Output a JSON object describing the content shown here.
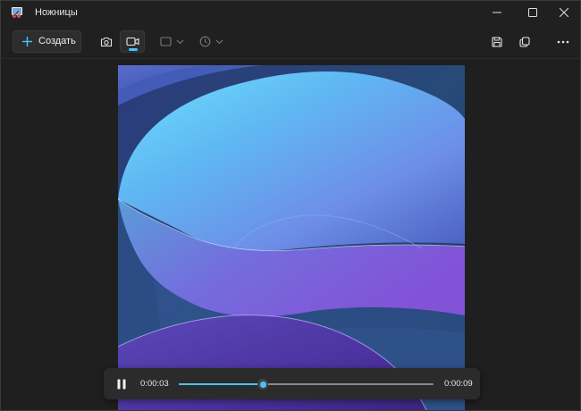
{
  "window": {
    "title": "Ножницы",
    "icons": {
      "app": "snipping-tool-icon",
      "minimize": "minimize-icon",
      "maximize": "maximize-icon",
      "close": "close-icon"
    }
  },
  "toolbar": {
    "create_label": "Создать",
    "create_icon": "plus-icon",
    "modes": [
      {
        "icon": "camera-icon",
        "selected": false
      },
      {
        "icon": "video-camera-icon",
        "selected": true
      }
    ],
    "shape_icon": "rectangle-icon",
    "timer_icon": "clock-icon",
    "right_icons": [
      "save-icon",
      "copy-icon",
      "more-icon"
    ],
    "accent_color": "#4cc2ff"
  },
  "player": {
    "state_icon": "pause-icon",
    "current_time": "0:00:03",
    "total_time": "0:00:09",
    "progress": 0.33
  }
}
